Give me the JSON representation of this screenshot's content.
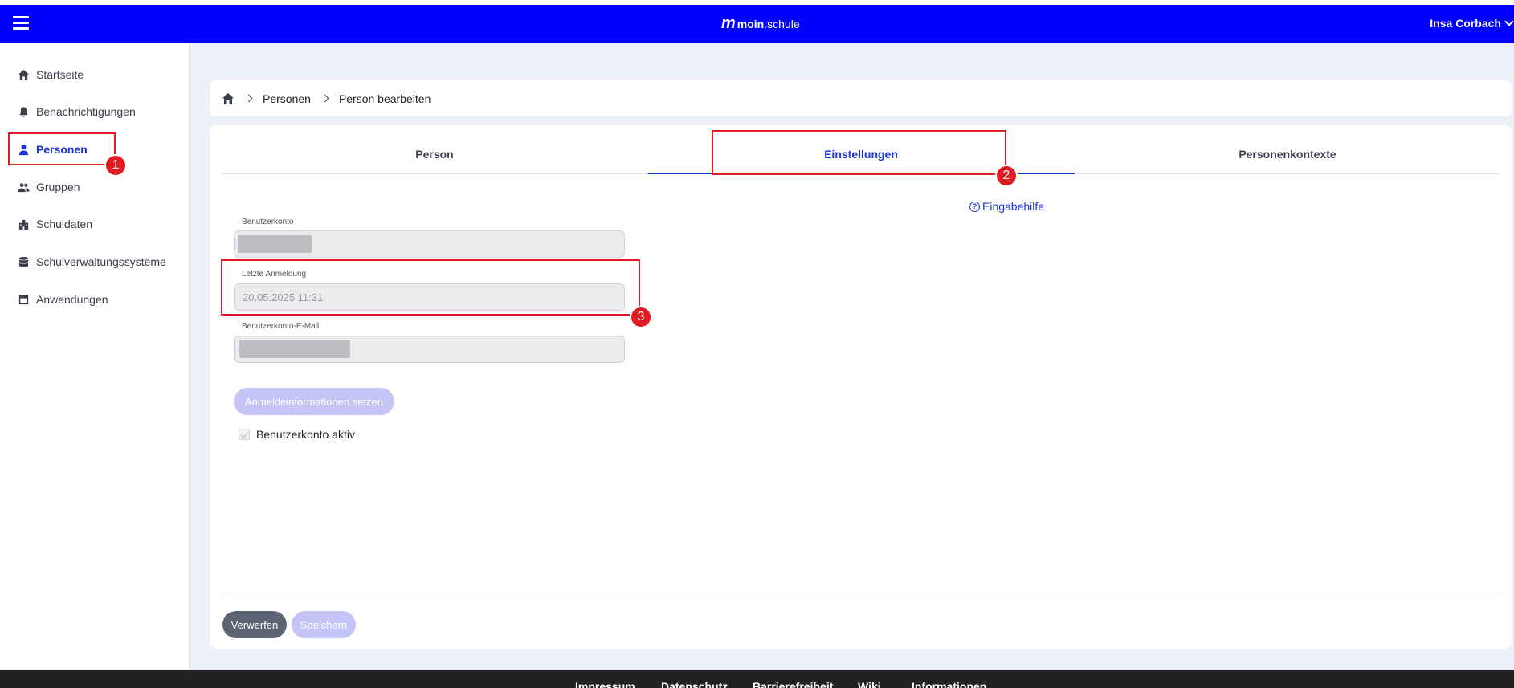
{
  "header": {
    "brand_bold": "moin",
    "brand_rest": ".schule",
    "user_name": "Insa Corbach"
  },
  "sidebar": {
    "items": [
      {
        "label": "Startseite",
        "icon": "home-icon"
      },
      {
        "label": "Benachrichtigungen",
        "icon": "bell-icon"
      },
      {
        "label": "Personen",
        "icon": "person-icon",
        "active": true
      },
      {
        "label": "Gruppen",
        "icon": "group-icon"
      },
      {
        "label": "Schuldaten",
        "icon": "school-icon"
      },
      {
        "label": "Schulverwaltungssysteme",
        "icon": "database-icon"
      },
      {
        "label": "Anwendungen",
        "icon": "app-icon"
      }
    ]
  },
  "breadcrumb": {
    "items": [
      "Personen",
      "Person bearbeiten"
    ]
  },
  "tabs": [
    {
      "label": "Person"
    },
    {
      "label": "Einstellungen",
      "active": true
    },
    {
      "label": "Personenkontexte"
    }
  ],
  "help_label": "Eingabehilfe",
  "form": {
    "account_label": "Benutzerkonto",
    "last_login_label": "Letzte Anmeldung",
    "last_login_value": "20.05.2025 11:31",
    "email_label": "Benutzerkonto-E-Mail",
    "set_credentials_button": "Anmeldeinformationen setzen",
    "account_active_label": "Benutzerkonto aktiv"
  },
  "actions": {
    "discard": "Verwerfen",
    "save": "Speichern"
  },
  "annotations": [
    "1",
    "2",
    "3"
  ],
  "footer": {
    "links": [
      "Impressum",
      "Datenschutz",
      "Barrierefreiheit",
      "Wiki",
      "Informationen"
    ]
  },
  "colors": {
    "brand": "#0000ff",
    "accent": "#1a33d9",
    "annotation": "#e01b22"
  }
}
